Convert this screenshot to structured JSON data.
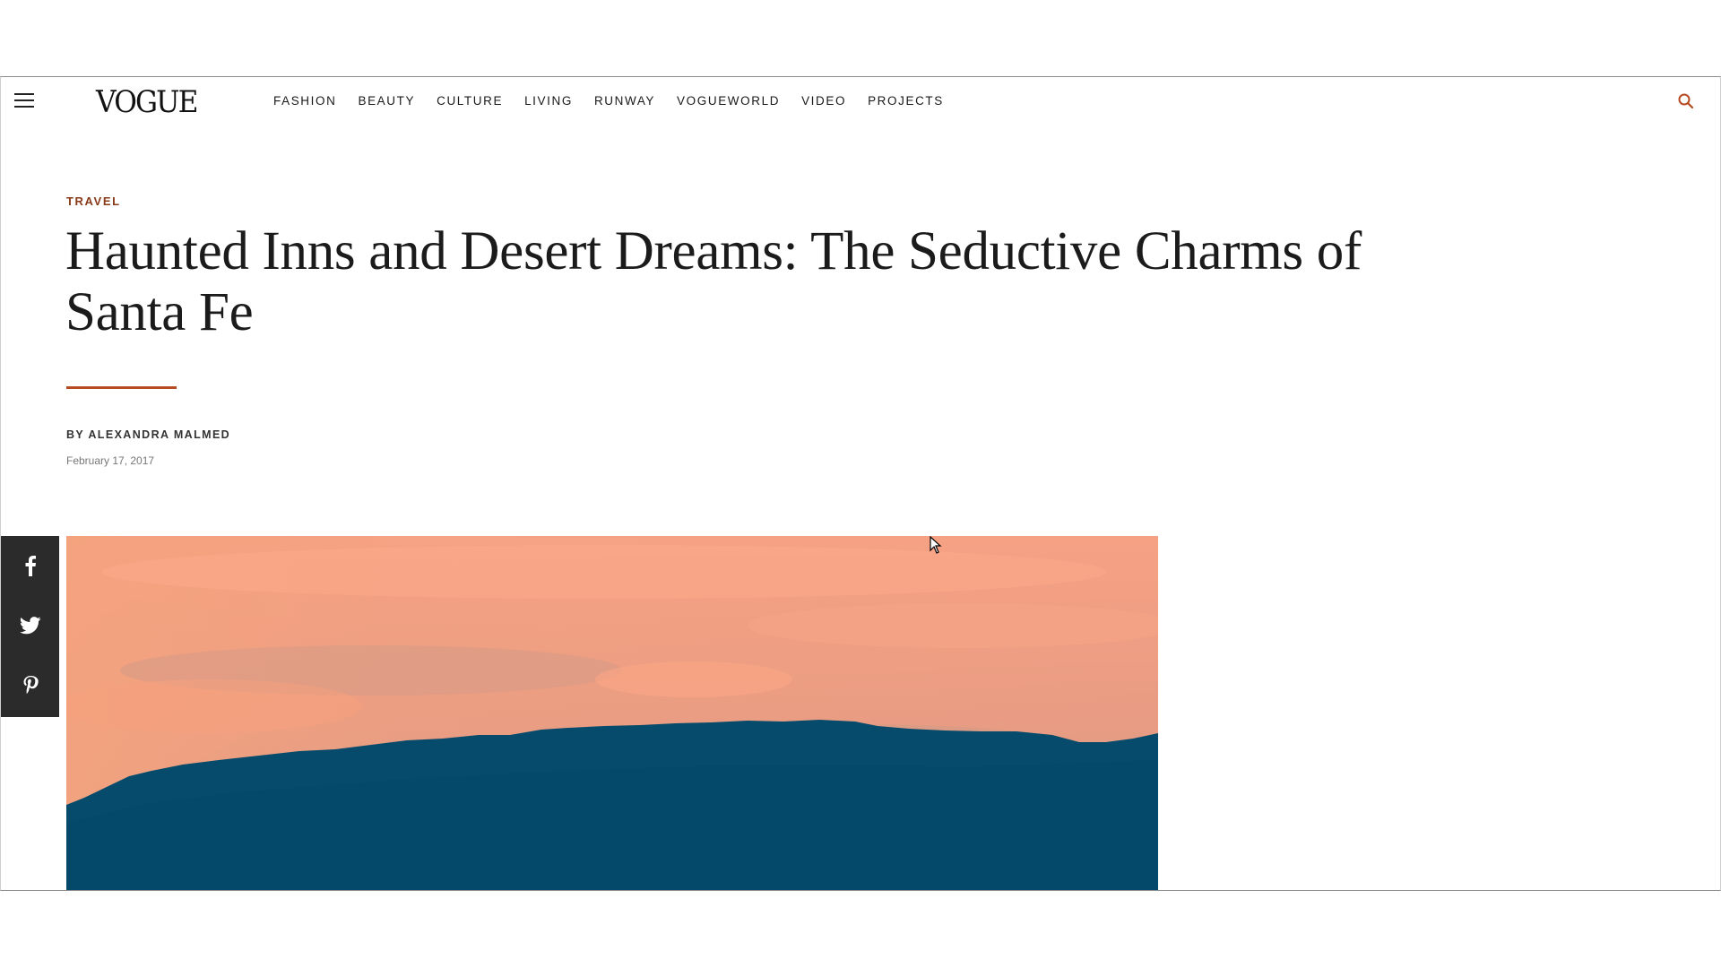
{
  "header": {
    "logo_text": "VOGUE",
    "nav": [
      "FASHION",
      "BEAUTY",
      "CULTURE",
      "LIVING",
      "RUNWAY",
      "VOGUEWORLD",
      "VIDEO",
      "PROJECTS"
    ],
    "menu_icon": "hamburger-menu-icon",
    "search_icon": "search-icon",
    "search_color": "#b64a22"
  },
  "article": {
    "section": "TRAVEL",
    "headline": "Haunted Inns and Desert Dreams: The Seductive Charms of Santa Fe",
    "byline_prefix": "BY",
    "author": "ALEXANDRA MALMED",
    "date": "February 17, 2017",
    "accent_color": "#b64a22"
  },
  "hero_image": {
    "description_colors": {
      "sky": "#f2a183",
      "mountain": "#064b6c"
    }
  },
  "share": {
    "icons": [
      "facebook-icon",
      "twitter-icon",
      "pinterest-icon"
    ],
    "background": "#2b2b2b"
  }
}
